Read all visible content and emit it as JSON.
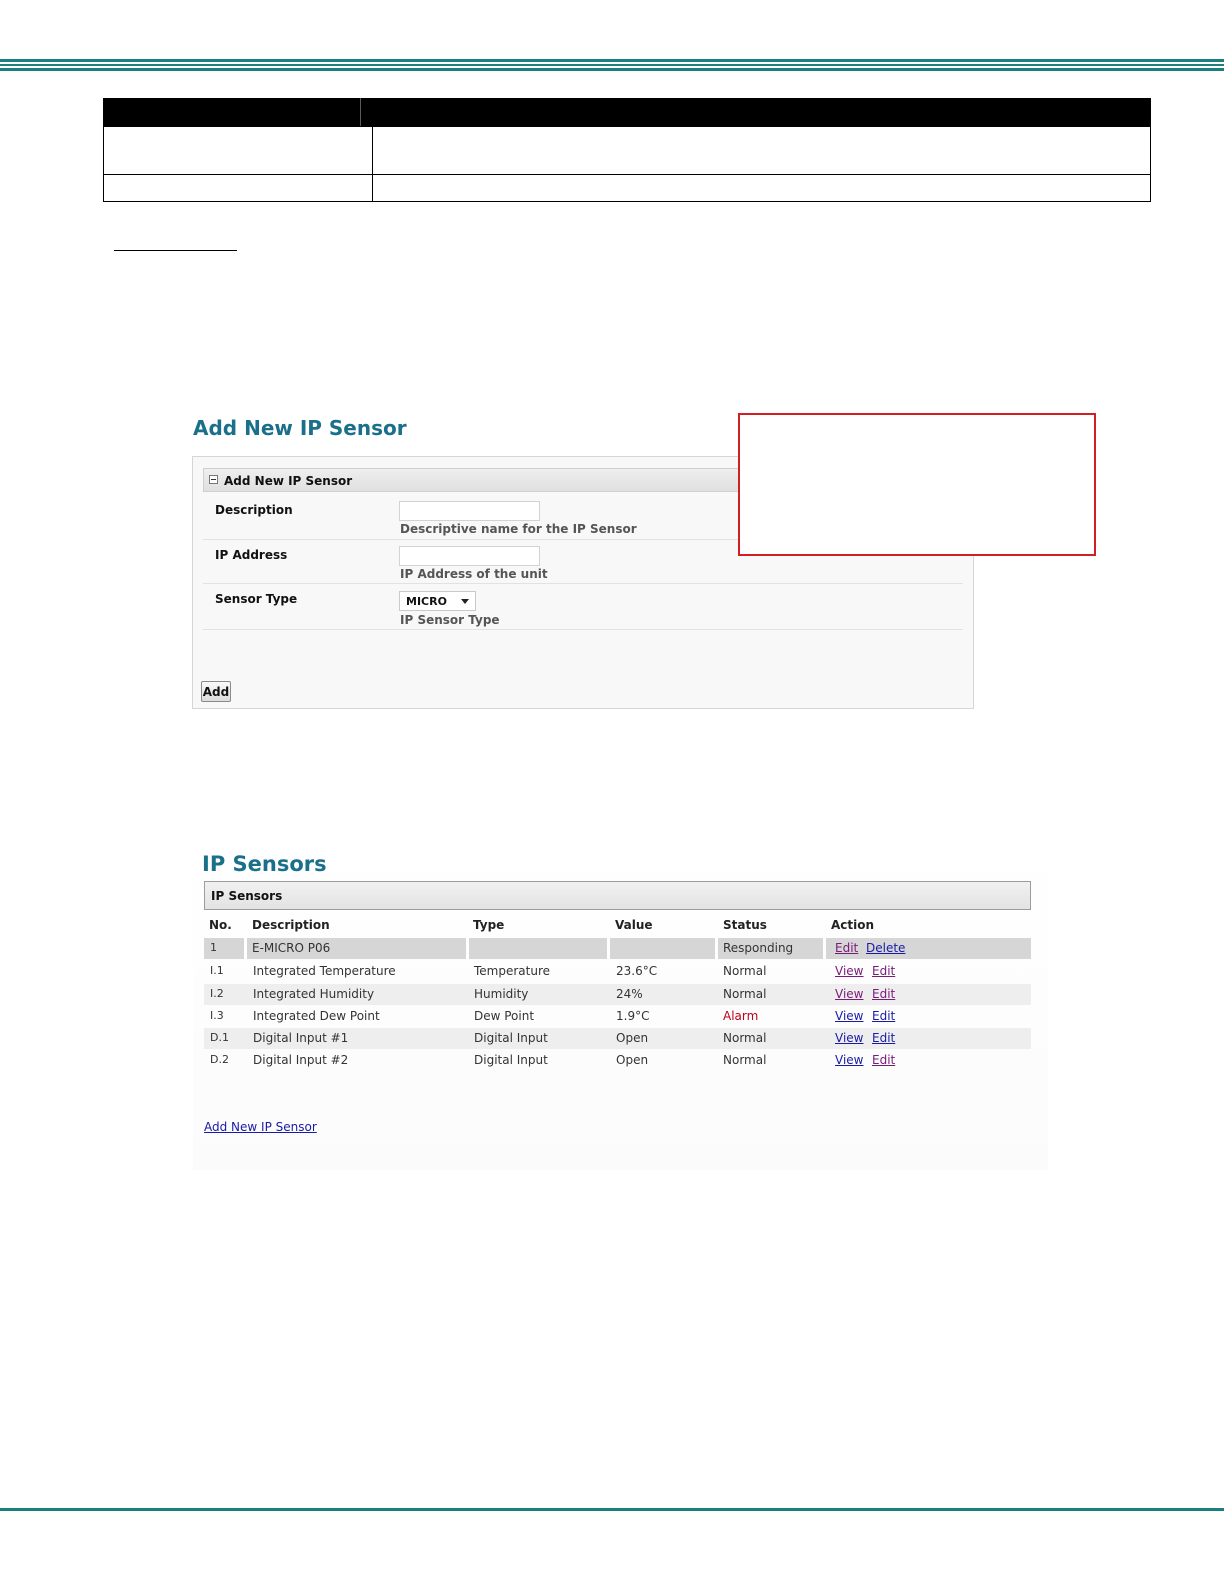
{
  "colors": {
    "header_line": "#1b7f7d",
    "title_teal": "#1a6f8a",
    "callout_border": "#d41e26",
    "alarm": "#c0001a",
    "link_blue": "#1a1aa8",
    "link_visited": "#7a1a7a"
  },
  "add_form": {
    "page_title": "Add New IP Sensor",
    "panel_title": "Add New IP Sensor",
    "collapse_icon": "minus-box-icon",
    "fields": {
      "description": {
        "label": "Description",
        "value": "",
        "help": "Descriptive name for the IP Sensor"
      },
      "ip_address": {
        "label": "IP Address",
        "value": "",
        "help": "IP Address of the unit"
      },
      "sensor_type": {
        "label": "Sensor Type",
        "value": "MICRO",
        "help": "IP Sensor Type"
      }
    },
    "add_button": "Add"
  },
  "ip_sensors": {
    "page_title": "IP Sensors",
    "panel_title": "IP Sensors",
    "columns": [
      "No.",
      "Description",
      "Type",
      "Value",
      "Status",
      "Action"
    ],
    "rows": [
      {
        "no": "1",
        "description": "E-MICRO P06",
        "type": "",
        "value": "",
        "status": "Responding",
        "actions": [
          "Edit",
          "Delete"
        ]
      },
      {
        "no": "I.1",
        "description": "Integrated Temperature",
        "type": "Temperature",
        "value": "23.6°C",
        "status": "Normal",
        "actions": [
          "View",
          "Edit"
        ]
      },
      {
        "no": "I.2",
        "description": "Integrated Humidity",
        "type": "Humidity",
        "value": "24%",
        "status": "Normal",
        "actions": [
          "View",
          "Edit"
        ]
      },
      {
        "no": "I.3",
        "description": "Integrated Dew Point",
        "type": "Dew Point",
        "value": "1.9°C",
        "status": "Alarm",
        "actions": [
          "View",
          "Edit"
        ]
      },
      {
        "no": "D.1",
        "description": "Digital Input #1",
        "type": "Digital Input",
        "value": "Open",
        "status": "Normal",
        "actions": [
          "View",
          "Edit"
        ]
      },
      {
        "no": "D.2",
        "description": "Digital Input #2",
        "type": "Digital Input",
        "value": "Open",
        "status": "Normal",
        "actions": [
          "View",
          "Edit"
        ]
      }
    ],
    "add_link": "Add New IP Sensor"
  }
}
